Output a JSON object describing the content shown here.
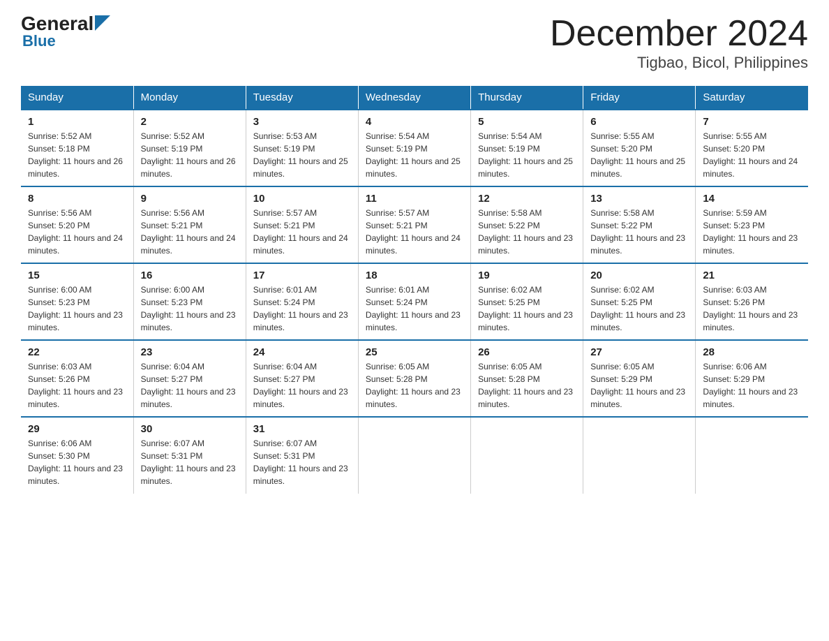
{
  "header": {
    "logo_general": "General",
    "logo_blue": "Blue",
    "month_title": "December 2024",
    "subtitle": "Tigbao, Bicol, Philippines"
  },
  "days_of_week": [
    "Sunday",
    "Monday",
    "Tuesday",
    "Wednesday",
    "Thursday",
    "Friday",
    "Saturday"
  ],
  "weeks": [
    [
      {
        "day": "1",
        "sunrise": "Sunrise: 5:52 AM",
        "sunset": "Sunset: 5:18 PM",
        "daylight": "Daylight: 11 hours and 26 minutes."
      },
      {
        "day": "2",
        "sunrise": "Sunrise: 5:52 AM",
        "sunset": "Sunset: 5:19 PM",
        "daylight": "Daylight: 11 hours and 26 minutes."
      },
      {
        "day": "3",
        "sunrise": "Sunrise: 5:53 AM",
        "sunset": "Sunset: 5:19 PM",
        "daylight": "Daylight: 11 hours and 25 minutes."
      },
      {
        "day": "4",
        "sunrise": "Sunrise: 5:54 AM",
        "sunset": "Sunset: 5:19 PM",
        "daylight": "Daylight: 11 hours and 25 minutes."
      },
      {
        "day": "5",
        "sunrise": "Sunrise: 5:54 AM",
        "sunset": "Sunset: 5:19 PM",
        "daylight": "Daylight: 11 hours and 25 minutes."
      },
      {
        "day": "6",
        "sunrise": "Sunrise: 5:55 AM",
        "sunset": "Sunset: 5:20 PM",
        "daylight": "Daylight: 11 hours and 25 minutes."
      },
      {
        "day": "7",
        "sunrise": "Sunrise: 5:55 AM",
        "sunset": "Sunset: 5:20 PM",
        "daylight": "Daylight: 11 hours and 24 minutes."
      }
    ],
    [
      {
        "day": "8",
        "sunrise": "Sunrise: 5:56 AM",
        "sunset": "Sunset: 5:20 PM",
        "daylight": "Daylight: 11 hours and 24 minutes."
      },
      {
        "day": "9",
        "sunrise": "Sunrise: 5:56 AM",
        "sunset": "Sunset: 5:21 PM",
        "daylight": "Daylight: 11 hours and 24 minutes."
      },
      {
        "day": "10",
        "sunrise": "Sunrise: 5:57 AM",
        "sunset": "Sunset: 5:21 PM",
        "daylight": "Daylight: 11 hours and 24 minutes."
      },
      {
        "day": "11",
        "sunrise": "Sunrise: 5:57 AM",
        "sunset": "Sunset: 5:21 PM",
        "daylight": "Daylight: 11 hours and 24 minutes."
      },
      {
        "day": "12",
        "sunrise": "Sunrise: 5:58 AM",
        "sunset": "Sunset: 5:22 PM",
        "daylight": "Daylight: 11 hours and 23 minutes."
      },
      {
        "day": "13",
        "sunrise": "Sunrise: 5:58 AM",
        "sunset": "Sunset: 5:22 PM",
        "daylight": "Daylight: 11 hours and 23 minutes."
      },
      {
        "day": "14",
        "sunrise": "Sunrise: 5:59 AM",
        "sunset": "Sunset: 5:23 PM",
        "daylight": "Daylight: 11 hours and 23 minutes."
      }
    ],
    [
      {
        "day": "15",
        "sunrise": "Sunrise: 6:00 AM",
        "sunset": "Sunset: 5:23 PM",
        "daylight": "Daylight: 11 hours and 23 minutes."
      },
      {
        "day": "16",
        "sunrise": "Sunrise: 6:00 AM",
        "sunset": "Sunset: 5:23 PM",
        "daylight": "Daylight: 11 hours and 23 minutes."
      },
      {
        "day": "17",
        "sunrise": "Sunrise: 6:01 AM",
        "sunset": "Sunset: 5:24 PM",
        "daylight": "Daylight: 11 hours and 23 minutes."
      },
      {
        "day": "18",
        "sunrise": "Sunrise: 6:01 AM",
        "sunset": "Sunset: 5:24 PM",
        "daylight": "Daylight: 11 hours and 23 minutes."
      },
      {
        "day": "19",
        "sunrise": "Sunrise: 6:02 AM",
        "sunset": "Sunset: 5:25 PM",
        "daylight": "Daylight: 11 hours and 23 minutes."
      },
      {
        "day": "20",
        "sunrise": "Sunrise: 6:02 AM",
        "sunset": "Sunset: 5:25 PM",
        "daylight": "Daylight: 11 hours and 23 minutes."
      },
      {
        "day": "21",
        "sunrise": "Sunrise: 6:03 AM",
        "sunset": "Sunset: 5:26 PM",
        "daylight": "Daylight: 11 hours and 23 minutes."
      }
    ],
    [
      {
        "day": "22",
        "sunrise": "Sunrise: 6:03 AM",
        "sunset": "Sunset: 5:26 PM",
        "daylight": "Daylight: 11 hours and 23 minutes."
      },
      {
        "day": "23",
        "sunrise": "Sunrise: 6:04 AM",
        "sunset": "Sunset: 5:27 PM",
        "daylight": "Daylight: 11 hours and 23 minutes."
      },
      {
        "day": "24",
        "sunrise": "Sunrise: 6:04 AM",
        "sunset": "Sunset: 5:27 PM",
        "daylight": "Daylight: 11 hours and 23 minutes."
      },
      {
        "day": "25",
        "sunrise": "Sunrise: 6:05 AM",
        "sunset": "Sunset: 5:28 PM",
        "daylight": "Daylight: 11 hours and 23 minutes."
      },
      {
        "day": "26",
        "sunrise": "Sunrise: 6:05 AM",
        "sunset": "Sunset: 5:28 PM",
        "daylight": "Daylight: 11 hours and 23 minutes."
      },
      {
        "day": "27",
        "sunrise": "Sunrise: 6:05 AM",
        "sunset": "Sunset: 5:29 PM",
        "daylight": "Daylight: 11 hours and 23 minutes."
      },
      {
        "day": "28",
        "sunrise": "Sunrise: 6:06 AM",
        "sunset": "Sunset: 5:29 PM",
        "daylight": "Daylight: 11 hours and 23 minutes."
      }
    ],
    [
      {
        "day": "29",
        "sunrise": "Sunrise: 6:06 AM",
        "sunset": "Sunset: 5:30 PM",
        "daylight": "Daylight: 11 hours and 23 minutes."
      },
      {
        "day": "30",
        "sunrise": "Sunrise: 6:07 AM",
        "sunset": "Sunset: 5:31 PM",
        "daylight": "Daylight: 11 hours and 23 minutes."
      },
      {
        "day": "31",
        "sunrise": "Sunrise: 6:07 AM",
        "sunset": "Sunset: 5:31 PM",
        "daylight": "Daylight: 11 hours and 23 minutes."
      },
      null,
      null,
      null,
      null
    ]
  ]
}
